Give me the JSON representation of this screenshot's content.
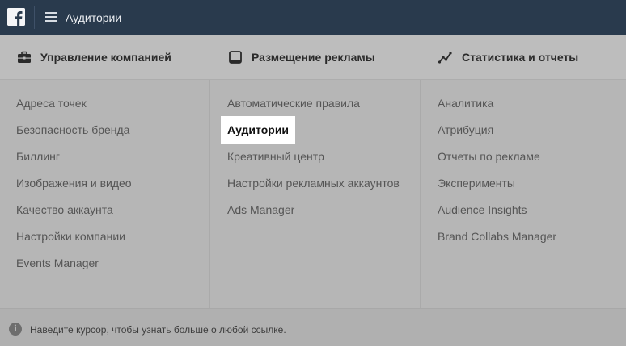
{
  "topbar": {
    "logo_icon": "facebook-f-icon",
    "menu_icon": "hamburger-icon",
    "title": "Аудитории"
  },
  "sections": [
    {
      "icon": "briefcase-icon",
      "title": "Управление компанией",
      "items": [
        "Адреса точек",
        "Безопасность бренда",
        "Биллинг",
        "Изображения и видео",
        "Качество аккаунта",
        "Настройки компании",
        "Events Manager"
      ]
    },
    {
      "icon": "tablet-icon",
      "title": "Размещение рекламы",
      "items": [
        "Автоматические правила",
        "Аудитории",
        "Креативный центр",
        "Настройки рекламных аккаунтов",
        "Ads Manager"
      ],
      "active_item": "Аудитории"
    },
    {
      "icon": "trend-line-icon",
      "title": "Статистика и отчеты",
      "items": [
        "Аналитика",
        "Атрибуция",
        "Отчеты по рекламе",
        "Эксперименты",
        "Audience Insights",
        "Brand Collabs Manager"
      ]
    }
  ],
  "footer": {
    "icon": "info-icon",
    "hint": "Наведите курсор, чтобы узнать больше о любой ссылке."
  },
  "colors": {
    "topbar_bg": "#293a4d",
    "overlay_bg": "#b6b6b6",
    "active_bg": "#ffffff"
  }
}
